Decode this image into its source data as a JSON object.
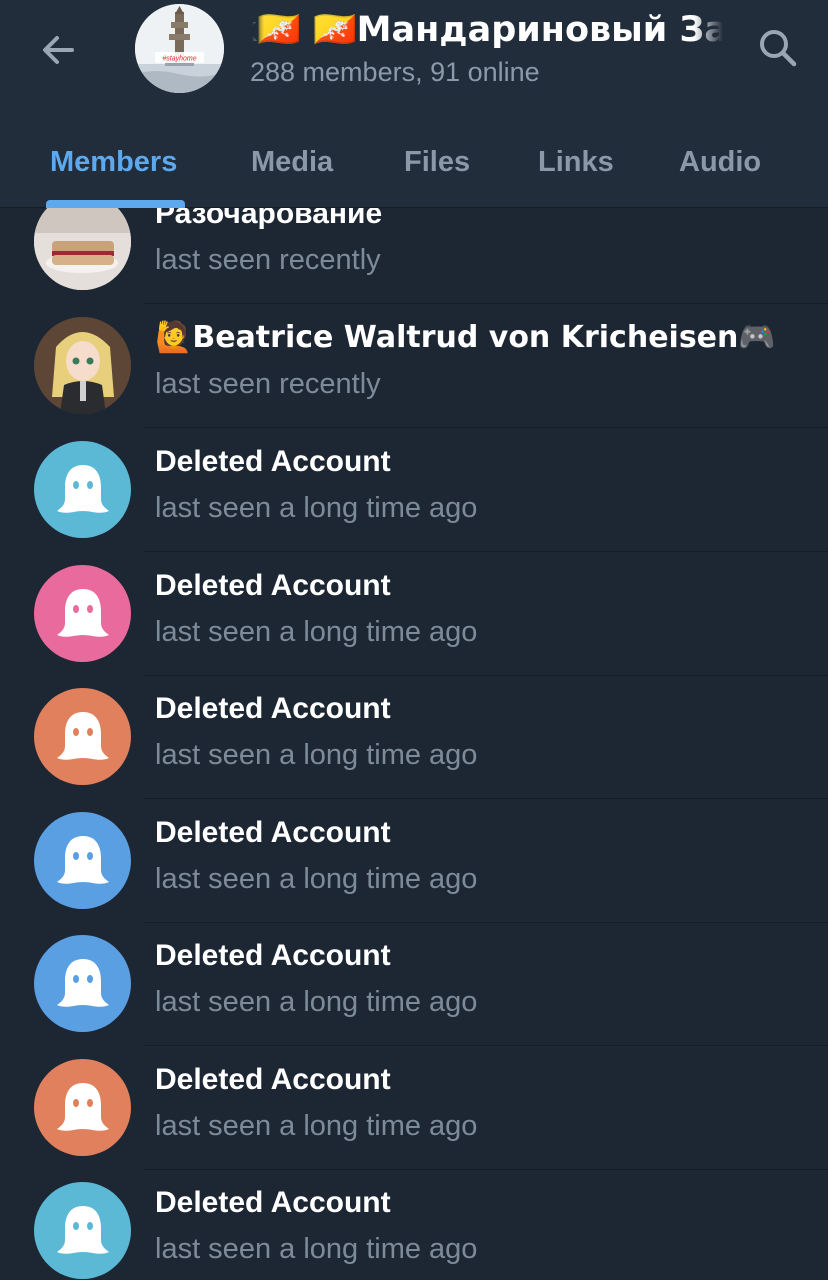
{
  "header": {
    "title": "к🇧🇹  🇧🇹Мандариновый За",
    "subtitle": "288 members, 91 online",
    "avatar_caption": "#stayhome"
  },
  "tabs": [
    {
      "label": "Members",
      "active": true
    },
    {
      "label": "Media",
      "active": false
    },
    {
      "label": "Files",
      "active": false
    },
    {
      "label": "Links",
      "active": false
    },
    {
      "label": "Audio",
      "active": false
    }
  ],
  "members": [
    {
      "name": "Разочарование",
      "status": "last seen recently",
      "avatar": "photo-sandwich"
    },
    {
      "name": "🙋Beatrice Waltrud von Kricheisen🎮",
      "status": "last seen recently",
      "avatar": "photo-anime"
    },
    {
      "name": "Deleted Account",
      "status": "last seen a long time ago",
      "avatar": "ghost-icon",
      "color": "#5bb9d6"
    },
    {
      "name": "Deleted Account",
      "status": "last seen a long time ago",
      "avatar": "ghost-icon",
      "color": "#e96a9c"
    },
    {
      "name": "Deleted Account",
      "status": "last seen a long time ago",
      "avatar": "ghost-icon",
      "color": "#e0805c"
    },
    {
      "name": "Deleted Account",
      "status": "last seen a long time ago",
      "avatar": "ghost-icon",
      "color": "#5a9fe2"
    },
    {
      "name": "Deleted Account",
      "status": "last seen a long time ago",
      "avatar": "ghost-icon",
      "color": "#5a9fe2"
    },
    {
      "name": "Deleted Account",
      "status": "last seen a long time ago",
      "avatar": "ghost-icon",
      "color": "#e0805c"
    },
    {
      "name": "Deleted Account",
      "status": "last seen a long time ago",
      "avatar": "ghost-icon",
      "color": "#5bb9d6"
    }
  ],
  "colors": {
    "background": "#1d2733",
    "header": "#212d3b",
    "accent": "#5ea9ee",
    "secondary_text": "#7d8b99"
  }
}
